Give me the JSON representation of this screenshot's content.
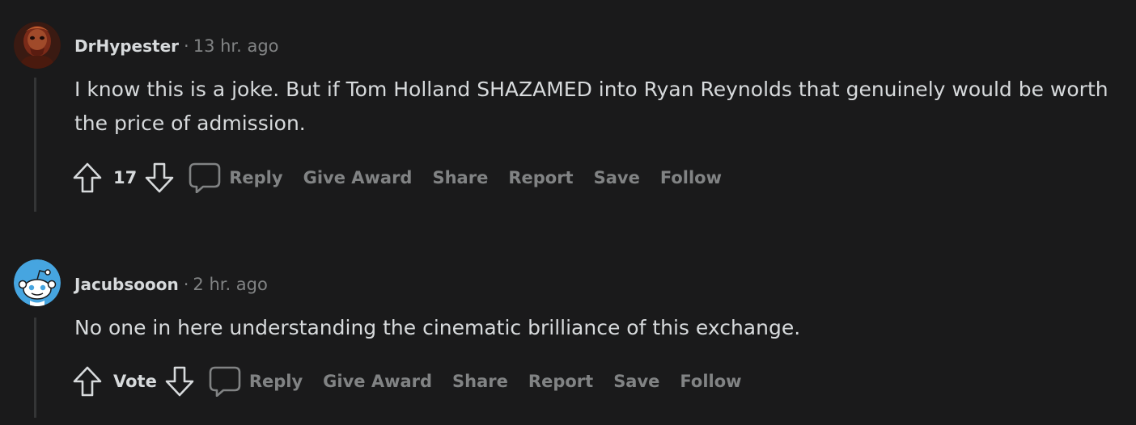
{
  "comments": [
    {
      "username": "DrHypester",
      "separator": "·",
      "time": "13 hr. ago",
      "text": "I know this is a joke. But if Tom Holland SHAZAMED into Ryan Reynolds that genuinely would be worth the price of admission.",
      "score": "17",
      "avatar_icon": "user-avatar-photo",
      "actions": {
        "reply": "Reply",
        "give_award": "Give Award",
        "share": "Share",
        "report": "Report",
        "save": "Save",
        "follow": "Follow"
      }
    },
    {
      "username": "Jacubsooon",
      "separator": "·",
      "time": "2 hr. ago",
      "text": "No one in here understanding the cinematic brilliance of this exchange.",
      "score": "Vote",
      "avatar_icon": "snoo-avatar",
      "actions": {
        "reply": "Reply",
        "give_award": "Give Award",
        "share": "Share",
        "report": "Report",
        "save": "Save",
        "follow": "Follow"
      }
    }
  ],
  "colors": {
    "background": "#1a1a1b",
    "text": "#d7dadc",
    "muted": "#818384",
    "thread_line": "#343536",
    "snoo_blue": "#46a5e0"
  }
}
